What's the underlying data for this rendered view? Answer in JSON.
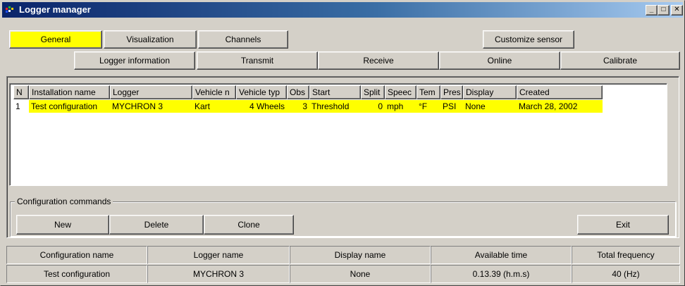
{
  "window": {
    "title": "Logger manager",
    "minimize_glyph": "_",
    "maximize_glyph": "□",
    "close_glyph": "✕"
  },
  "tabs_row1": [
    {
      "label": "General",
      "active": true
    },
    {
      "label": "Visualization",
      "active": false
    },
    {
      "label": "Channels",
      "active": false
    },
    {
      "label": "Customize sensor",
      "active": false
    }
  ],
  "tabs_row2": [
    {
      "label": "Logger information"
    },
    {
      "label": "Transmit"
    },
    {
      "label": "Receive"
    },
    {
      "label": "Online"
    },
    {
      "label": "Calibrate"
    }
  ],
  "table": {
    "columns": [
      "N",
      "Installation name",
      "Logger",
      "Vehicle n",
      "Vehicle typ",
      "Obs",
      "Start",
      "Split",
      "Speec",
      "Tem",
      "Pres",
      "Display",
      "Created",
      ""
    ],
    "rows": [
      [
        "1",
        "Test configuration",
        "MYCHRON 3",
        "Kart",
        "4 Wheels",
        "3",
        "Threshold",
        "0",
        "mph",
        "°F",
        "PSI",
        "None",
        "March 28, 2002"
      ]
    ]
  },
  "commands": {
    "group_label": "Configuration commands",
    "new_label": "New",
    "delete_label": "Delete",
    "clone_label": "Clone",
    "exit_label": "Exit"
  },
  "status": {
    "headers": [
      "Configuration name",
      "Logger name",
      "Display name",
      "Available time",
      "Total frequency"
    ],
    "values": [
      "Test configuration",
      "MYCHRON 3",
      "None",
      "0.13.39 (h.m.s)",
      "40 (Hz)"
    ]
  },
  "colors": {
    "active_tab": "#ffff00",
    "selected_row": "#ffff00",
    "title_start": "#0a246a",
    "title_end": "#a6caf0",
    "face": "#d4d0c8"
  }
}
